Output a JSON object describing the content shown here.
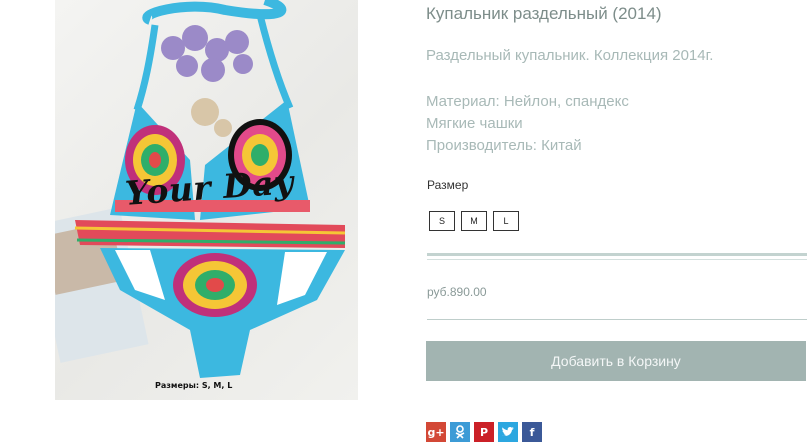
{
  "product": {
    "title": "Купальник раздельный (2014)",
    "description": "Раздельный купальник. Коллекция 2014г.",
    "specs": [
      "Материал: Нейлон, спандекс",
      "Мягкие чашки",
      "Производитель: Китай"
    ],
    "size_label": "Размер",
    "sizes": [
      "S",
      "M",
      "L"
    ],
    "price": "руб.890.00",
    "add_to_cart": "Добавить в Корзину"
  },
  "photo": {
    "logo_text": "Your Day",
    "caption": "Размеры: S, M, L"
  },
  "share": [
    {
      "name": "google-plus",
      "glyph": "g+",
      "color": "#d34836"
    },
    {
      "name": "odnoklassniki",
      "glyph": "ok",
      "color": "#3c9bd6"
    },
    {
      "name": "pinterest",
      "glyph": "P",
      "color": "#cb2027"
    },
    {
      "name": "twitter",
      "glyph": "t",
      "color": "#2ca7e0"
    },
    {
      "name": "facebook",
      "glyph": "f",
      "color": "#3b5998"
    }
  ],
  "colors": {
    "accent_button": "#a2b4b1",
    "swimsuit": "#3cb8e0"
  }
}
